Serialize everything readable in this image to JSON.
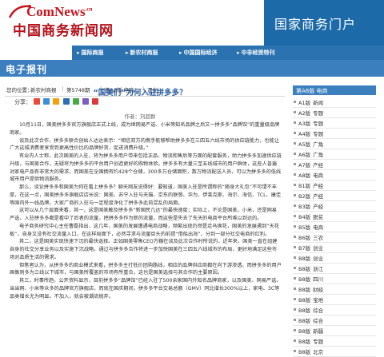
{
  "header": {
    "logo_en_main": "ComNews",
    "logo_en_suffix": ".cn",
    "logo_cn": "中国商务新闻网",
    "portal_title": "国家商务门户"
  },
  "nav": {
    "items": [
      "国际商报",
      "新农村商报",
      "中国国际经济",
      "中非经贸特刊"
    ]
  },
  "section": {
    "title": "电子报刊"
  },
  "breadcrumb": {
    "prefix": "您的位置：",
    "items": [
      "新农村商报",
      "第5748期",
      "第A8版 电商",
      "正文"
    ]
  },
  "article": {
    "title": "“国美们”为何入驻拼多多？",
    "share_label": "分享：",
    "author": "作者：刘超群",
    "paragraphs": [
      "10月11日，国美拼多多官方旗舰店正式上线，成为继网易严选、小米等知名品牌之后又一拼多多“品牌馆”的重量级品牌商家。",
      "谈及此次合作，拼多多联合创始人达达表示：“相信双方的携手能够帮助拼多多在三四五六线市场的供应链能力，也能让广大这城消费者享受到更高性价比的品牌好货，促进消费升级。”",
      "有业内人士称，此次国美的入驻，将为拼多多用户带来包括正品、物流和售后等方面的配套服务，助力拼多多加速供应链升级，与国美合作，无疑将为拼多多的平台用户创造更好的购物体验。拼多多有大量三至五线城市的用户群体，这些人普遍对家电产品有非常大的需求。而国美在全国拥有约428个仓储，300多万仓储面积，数万物流配送人员，可以为拼多多的低线城市用户提供物流服务。",
      "那么，谈论拼多多和国美为何在看上拼多多？聊天网友说得好：要知道，国美入驻是所谓称的“随身大礼包”不可谓不丰厚，在这一点，国美拼多多旗舰店店长说：国美、苏宁入驻与天猫、京东的联想、华为、伊莱克斯、海尔、海信、TCL、康佳等国内外一线品牌。大家广商的入驻与一定程度净化了拼多多此前混乱的局面。",
      "这可以从几个层面来看，其一，这是国美触及拼多多“新国民几达”的最快速度；实际上，不论是国美，小米，还是网易严选，入驻拼多多都是看中了后者的流量，把拼多多作为新的流量，而这些是失去了先天的电商平台所难以到达的。",
      "电子商务研究中心主任曹磊指出，这几年，国美的发展遭遇电商战略，频繁出现仍然是走马换花，国美的发展遇到“天花板”，自身又没有社交流量入口，在这样局面下，必然寻求与流量巨头的前提“借船出海”，分到一部分社交电商的红利。",
      "其二，这是国美实现快速下沉的最快选择。正如国美零售CEO方巍在谈及此次合作时所说的，近年来，国美一直在组建自身的社交分享业务以及实施下沉战略，通过与拼多多合作将进一步加快国美在三四五六线城市的布局，更好地满足这些市场对品质生活的需求。",
      "但笔者认为，从拼多多的商业模式来看，拼多多主打低价团购路线，相应的品牌供应商都在向下游渗透。而拼多多的用户画像则多为三线以下城市，与国美所覆盖的市场有所重合，这也是国美选择与其合作的主要原因。",
      "其三，时事所趋。公开资料显示，目前拼多多“品牌馆”已经入驻了500余家国内外知名品牌商家，以及国美、网易严选、当当网、小米等众多的品牌官方旗舰店，而就在国庆期间，拼多多平台交易总额（GMV）同比增长300%以上，家电、3C等品类增长尤为明显。不加入，就会被潮流抛弃。"
    ]
  },
  "sidebar": {
    "current_label": "第A8版 电商",
    "items": [
      {
        "ed": "A1版",
        "name": "新闻"
      },
      {
        "ed": "A2版",
        "name": "专题"
      },
      {
        "ed": "A3版",
        "name": "专题"
      },
      {
        "ed": "A4版",
        "name": "专题"
      },
      {
        "ed": "A5版",
        "name": "广角"
      },
      {
        "ed": "A6版",
        "name": "广角"
      },
      {
        "ed": "A7版",
        "name": "产经"
      },
      {
        "ed": "A8版",
        "name": "电商"
      },
      {
        "ed": "B1版",
        "name": "产经"
      },
      {
        "ed": "B2版",
        "name": "产经"
      },
      {
        "ed": "B3版",
        "name": "产经"
      },
      {
        "ed": "B4版",
        "name": "脱贫"
      },
      {
        "ed": "B5版",
        "name": "电商"
      },
      {
        "ed": "B6版",
        "name": "三农"
      },
      {
        "ed": "B7版",
        "name": "创业"
      },
      {
        "ed": "B8版",
        "name": "创业"
      },
      {
        "ed": "B8版",
        "name": "浙江"
      },
      {
        "ed": "B8版",
        "name": "四川"
      },
      {
        "ed": "B8版",
        "name": "财经"
      },
      {
        "ed": "B8版",
        "name": "宝地"
      },
      {
        "ed": "B8版",
        "name": "综合"
      },
      {
        "ed": "B8版",
        "name": "综合"
      },
      {
        "ed": "B8版",
        "name": "新疆"
      },
      {
        "ed": "B8版",
        "name": "专题"
      },
      {
        "ed": "B8版",
        "name": "北京"
      }
    ]
  },
  "colors": {
    "brand_red": "#c8141e",
    "brand_blue": "#2a72b0",
    "bar_blue": "#3b7fbf",
    "title_blue": "#2a5a9c"
  }
}
